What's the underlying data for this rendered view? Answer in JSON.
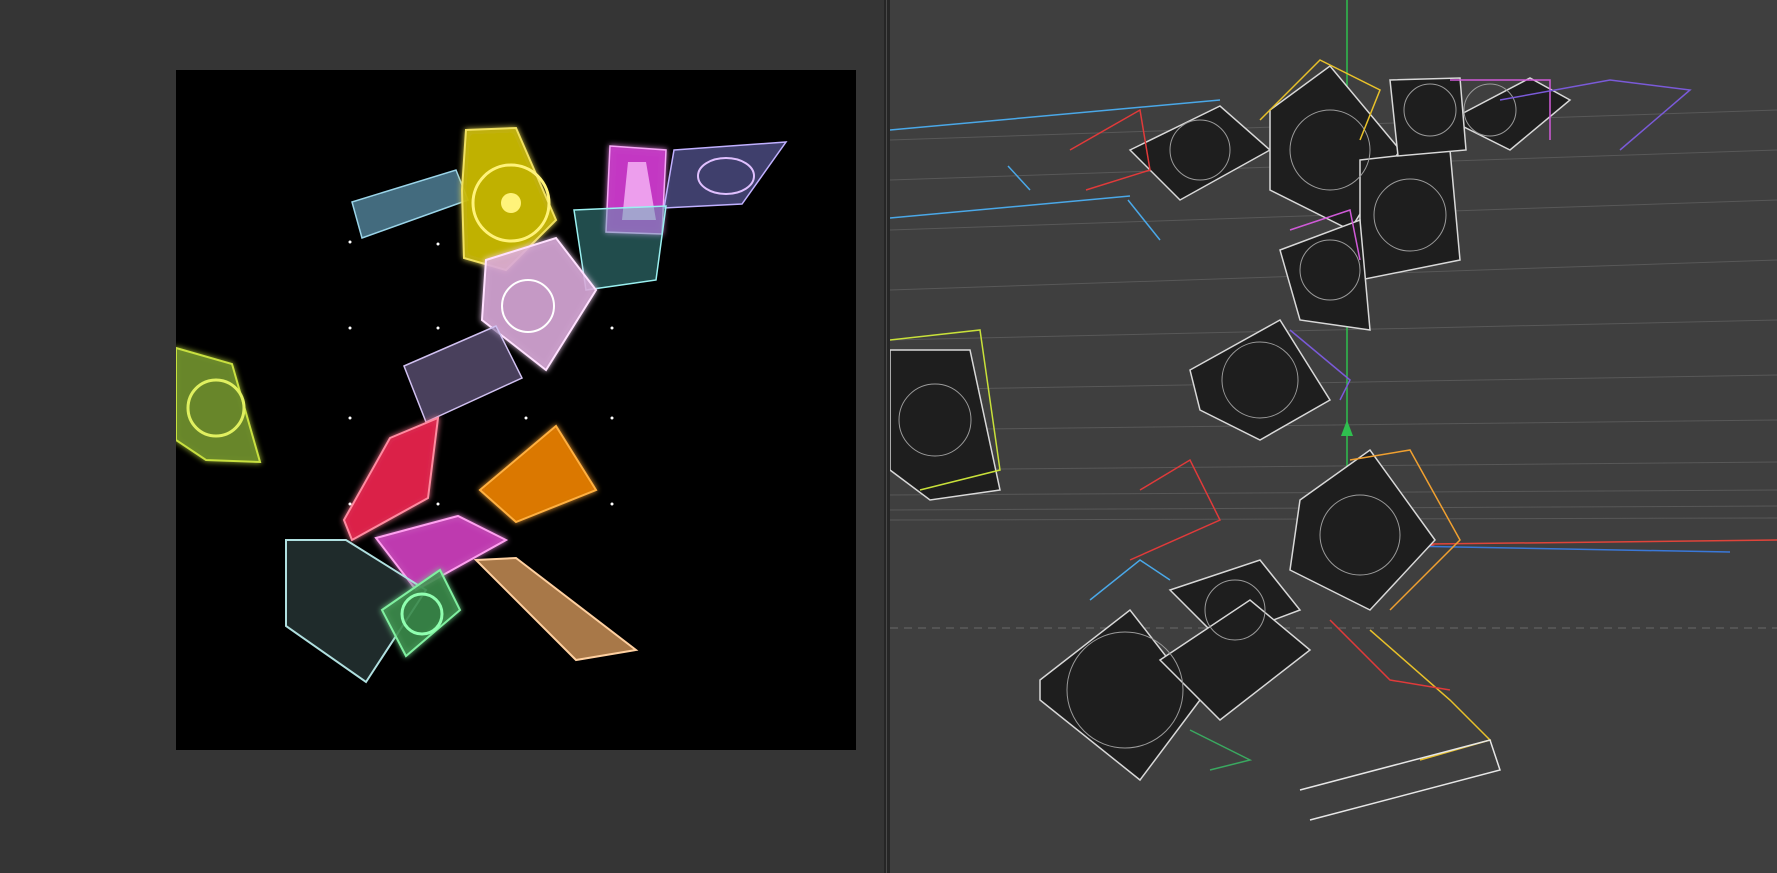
{
  "render_view": {
    "background": "#000000"
  },
  "viewport_3d": {
    "background": "#3f3f3f",
    "axis_colors": {
      "x": "#e0443a",
      "y": "#2fbf4f",
      "z": "#3a78d8"
    },
    "wireframe_colors": [
      "#e6e6e6",
      "#e8c12a",
      "#e03a3a",
      "#d05ad8",
      "#4aa8e8",
      "#7a5ad8",
      "#c8e03a",
      "#3aa860",
      "#f0a030"
    ]
  }
}
